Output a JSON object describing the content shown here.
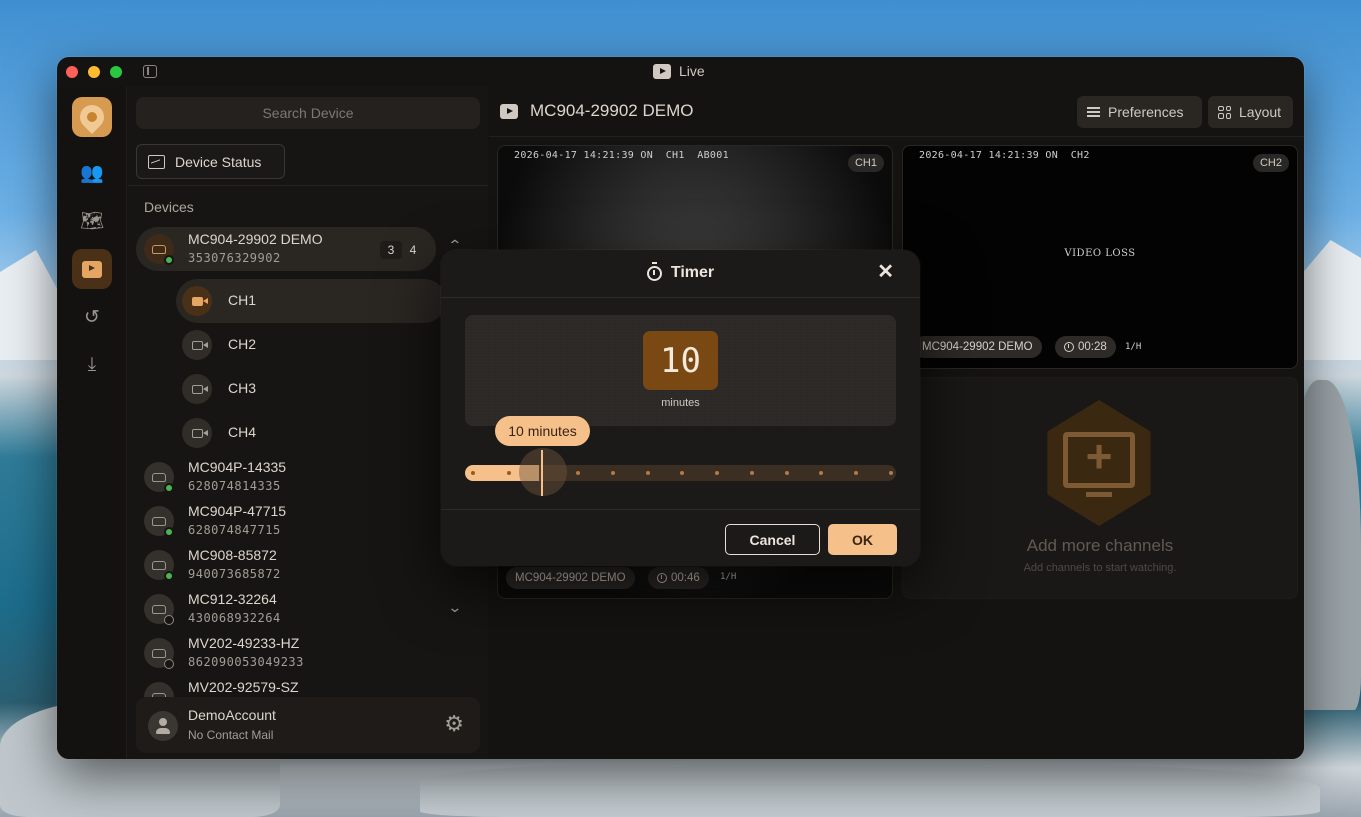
{
  "window": {
    "title": "Live"
  },
  "colors": {
    "accent": "#f6c08a",
    "active_nav": "#4a3017",
    "online": "#4bb552"
  },
  "rail": {
    "items": [
      {
        "icon": "users-icon"
      },
      {
        "icon": "map-icon"
      },
      {
        "icon": "live-play-icon",
        "active": true
      },
      {
        "icon": "history-icon"
      },
      {
        "icon": "download-icon"
      }
    ]
  },
  "sidebar": {
    "search_placeholder": "Search Device",
    "status_button": "Device Status",
    "devices_label": "Devices",
    "devices": [
      {
        "name": "MC904-29902 DEMO",
        "id": "353076329902",
        "online": true,
        "counts": [
          "3",
          "4"
        ],
        "expanded": true,
        "channels": [
          "CH1",
          "CH2",
          "CH3",
          "CH4"
        ]
      },
      {
        "name": "MC904P-14335",
        "id": "628074814335",
        "online": true
      },
      {
        "name": "MC904P-47715",
        "id": "628074847715",
        "online": true
      },
      {
        "name": "MC908-85872",
        "id": "940073685872",
        "online": true
      },
      {
        "name": "MC912-32264",
        "id": "430068932264",
        "online": false
      },
      {
        "name": "MV202-49233-HZ",
        "id": "862090053049233",
        "online": false
      },
      {
        "name": "MV202-92579-SZ",
        "id": "",
        "online": false
      }
    ],
    "account": {
      "name": "DemoAccount",
      "mail": "No Contact Mail"
    }
  },
  "main": {
    "title": "MC904-29902 DEMO",
    "preferences_label": "Preferences",
    "layout_label": "Layout",
    "tiles": {
      "ch1": {
        "osd": "2026-04-17 14:21:39 ON  CH1  AB001",
        "badge": "CH1",
        "device": "MC904-29902 DEMO",
        "elapsed": "00:46",
        "extra": "1/H"
      },
      "ch2": {
        "osd": "2026-04-17 14:21:39 ON  CH2",
        "badge": "CH2",
        "status": "VIDEO LOSS",
        "device": "MC904-29902 DEMO",
        "elapsed": "00:28",
        "extra": "1/H"
      },
      "add": {
        "title": "Add more channels",
        "subtitle": "Add channels to start watching."
      }
    }
  },
  "modal": {
    "title": "Timer",
    "value": "10",
    "unit": "minutes",
    "tooltip": "10 minutes",
    "slider_fraction": 0.18,
    "cancel_label": "Cancel",
    "ok_label": "OK"
  }
}
